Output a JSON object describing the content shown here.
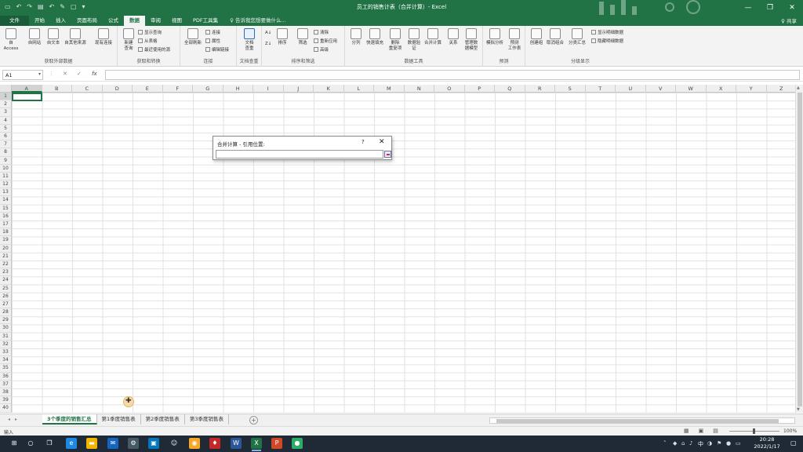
{
  "window": {
    "title": "员工的销售计表（合并计算）- Excel",
    "minimize": "—",
    "restore": "❐",
    "close": "✕"
  },
  "tabs": {
    "file": "文件",
    "items": [
      "开始",
      "插入",
      "页面布局",
      "公式",
      "数据",
      "审阅",
      "视图",
      "PDF工具集"
    ],
    "active_index": 4,
    "tell_me": "♀ 告诉我您想要做什么...",
    "share": "♀ 共享"
  },
  "ribbon": {
    "groups": {
      "external": {
        "label": "获取外部数据",
        "buttons": [
          "自 Access",
          "自网站",
          "自文本",
          "自其他来源",
          "现有连接"
        ]
      },
      "transform": {
        "label": "获取和转换",
        "new_query": "新建\n查询",
        "small": [
          "显示查询",
          "从表格",
          "最近使用的源"
        ]
      },
      "connections": {
        "label": "连接",
        "refresh_all": "全部刷新",
        "small": [
          "连接",
          "属性",
          "编辑链接"
        ]
      },
      "order": {
        "label": "排序和筛选",
        "sort": "排序",
        "filter": "筛选",
        "small": [
          "清除",
          "重新应用",
          "高级"
        ]
      },
      "compare": {
        "label": "文档查重",
        "button": "文档\n查重"
      },
      "tools": {
        "label": "数据工具",
        "buttons": [
          "分列",
          "快速填充",
          "删除\n重复项",
          "数据验\n证",
          "合并计算",
          "关系",
          "管理数\n据模型"
        ]
      },
      "forecast": {
        "label": "预测",
        "buttons": [
          "模拟分析",
          "预测\n工作表"
        ]
      },
      "outline": {
        "label": "分级显示",
        "buttons": [
          "创建组",
          "取消组合",
          "分类汇总"
        ],
        "small": [
          "显示明细数据",
          "隐藏明细数据"
        ]
      }
    }
  },
  "formula_bar": {
    "name_box": "A1",
    "cancel": "✕",
    "enter": "✓",
    "fx": "fx",
    "value": ""
  },
  "grid": {
    "columns": [
      "A",
      "B",
      "C",
      "D",
      "E",
      "F",
      "G",
      "H",
      "I",
      "J",
      "K",
      "L",
      "M",
      "N",
      "O",
      "P",
      "Q",
      "R",
      "S",
      "T",
      "U",
      "V",
      "W",
      "X",
      "Y",
      "Z"
    ],
    "row_count": 40,
    "active_cell": "A1"
  },
  "dialog": {
    "title": "合并计算 - 引用位置:",
    "help": "?",
    "close": "✕",
    "input_value": ""
  },
  "sheets": {
    "items": [
      "3个季度的销售汇总",
      "第1季度销售表",
      "第2季度销售表",
      "第3季度销售表"
    ],
    "active_index": 0,
    "add": "+"
  },
  "status": {
    "mode": "输入",
    "zoom": "100%"
  },
  "taskbar": {
    "icons": [
      {
        "name": "windows-start-icon",
        "glyph": "⊞",
        "color": "#1f2a36"
      },
      {
        "name": "search-icon",
        "glyph": "○",
        "color": "#1f2a36"
      },
      {
        "name": "task-view-icon",
        "glyph": "❐",
        "color": "#1f2a36"
      },
      {
        "name": "edge-icon",
        "glyph": "e",
        "color": "#1e88e5"
      },
      {
        "name": "file-explorer-icon",
        "glyph": "▬",
        "color": "#f2b600"
      },
      {
        "name": "mail-icon",
        "glyph": "✉",
        "color": "#1565c0"
      },
      {
        "name": "settings-icon",
        "glyph": "⚙",
        "color": "#455a64"
      },
      {
        "name": "store-icon",
        "glyph": "▣",
        "color": "#0277bd"
      },
      {
        "name": "qq-icon",
        "glyph": "☺",
        "color": "#1f2a36"
      },
      {
        "name": "chrome-icon",
        "glyph": "◉",
        "color": "#f9a825"
      },
      {
        "name": "app-icon",
        "glyph": "♦",
        "color": "#c62828"
      },
      {
        "name": "word-icon",
        "glyph": "W",
        "color": "#2b579a"
      },
      {
        "name": "excel-icon",
        "glyph": "X",
        "color": "#217346"
      },
      {
        "name": "powerpoint-icon",
        "glyph": "P",
        "color": "#d24726"
      },
      {
        "name": "wechat-icon",
        "glyph": "●",
        "color": "#2aae67"
      }
    ],
    "active_app": "excel-icon",
    "ime": "中",
    "time": "20:28",
    "date": "2022/1/17"
  },
  "colors": {
    "accent": "#217346"
  }
}
